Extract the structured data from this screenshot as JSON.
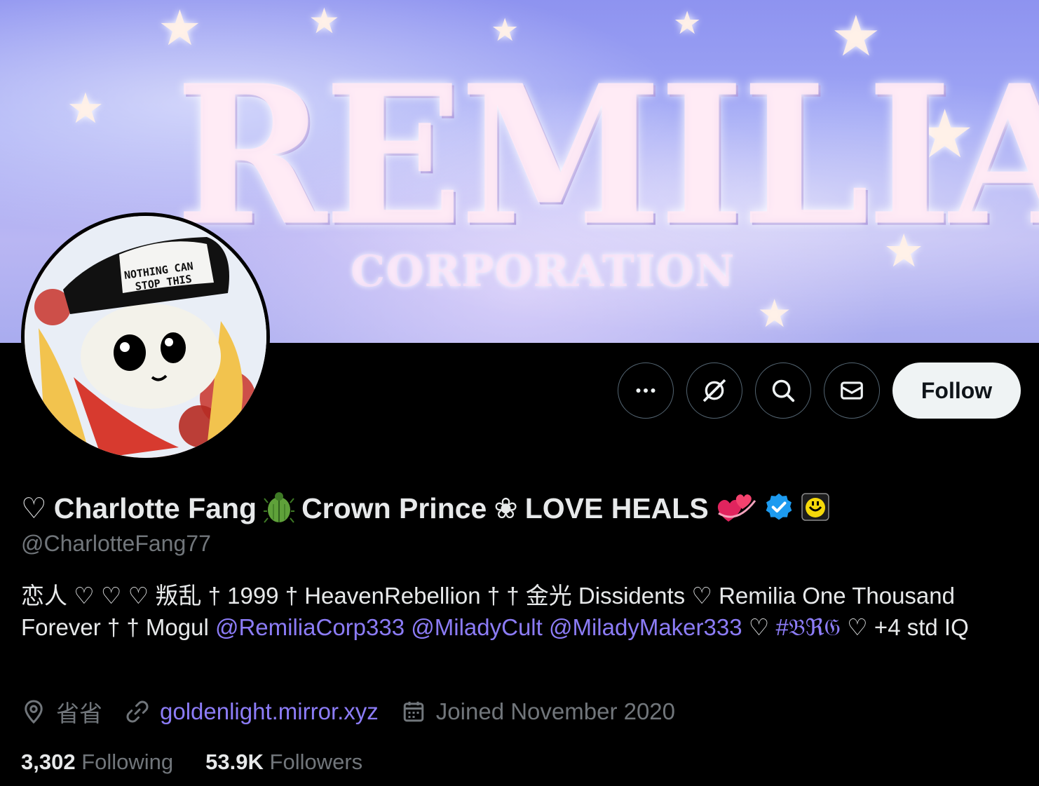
{
  "banner": {
    "headline": "REMILIA",
    "subline": "CORPORATION"
  },
  "avatar": {
    "cap_text_line1": "NOTHING CAN",
    "cap_text_line2": "STOP THIS"
  },
  "actions": {
    "more_icon": "more-icon",
    "grok_icon": "grok-icon",
    "search_icon": "search-icon",
    "message_icon": "mail-icon",
    "follow_label": "Follow"
  },
  "profile": {
    "name_prefix": "♡",
    "name_part1": "Charlotte Fang",
    "name_emoji1": "🪲",
    "name_part2": "Crown Prince",
    "name_flower": "❀",
    "name_part3": "LOVE HEALS",
    "name_emoji2": "💞",
    "verified_color": "#1d9bf0",
    "affiliate_badge_color": "#f5d90a",
    "handle": "@CharlotteFang77"
  },
  "bio": {
    "text1": "恋人 ♡ ♡ ♡ 叛乱 † 1999 † HeavenRebellion † † 金光 Dissidents ♡ Remilia One Thousand Forever † † Mogul ",
    "mention1": "@RemiliaCorp333",
    "mention2": "@MiladyCult",
    "mention3": "@MiladyMaker333",
    "sep": " ♡ ",
    "hashtag": "#𝔅ℜ𝔊",
    "text2": " ♡ +4 std IQ"
  },
  "meta": {
    "location": "省省",
    "url": "goldenlight.mirror.xyz",
    "joined": "Joined November 2020"
  },
  "stats": {
    "following_count": "3,302",
    "following_label": "Following",
    "followers_count": "53.9K",
    "followers_label": "Followers"
  },
  "colors": {
    "link": "#8c7cf7",
    "muted": "#71767b",
    "text": "#e7e9ea",
    "background": "#000000"
  }
}
